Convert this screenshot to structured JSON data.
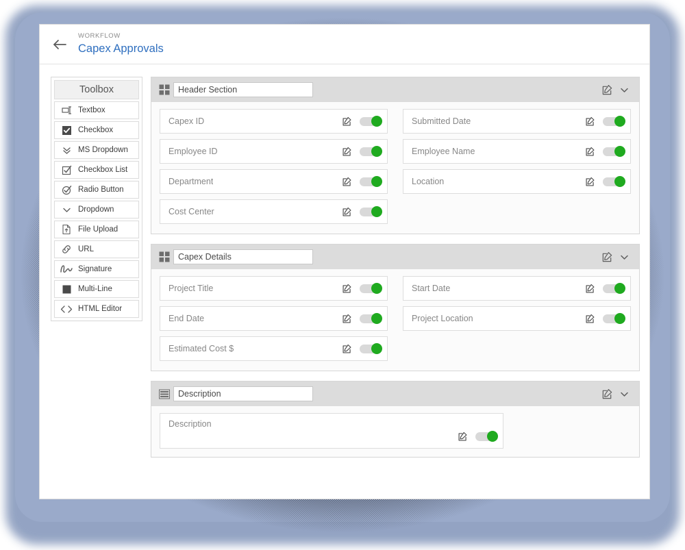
{
  "header": {
    "back_icon": "arrow-left-icon",
    "eyebrow": "WORKFLOW",
    "title": "Capex Approvals",
    "title_color": "#2f6fbf"
  },
  "toolbox": {
    "title": "Toolbox",
    "items": [
      {
        "label": "Textbox",
        "icon": "textbox-icon"
      },
      {
        "label": "Checkbox",
        "icon": "checkbox-checked-icon"
      },
      {
        "label": "MS Dropdown",
        "icon": "double-chevron-down-icon"
      },
      {
        "label": "Checkbox List",
        "icon": "checkbox-list-icon"
      },
      {
        "label": "Radio Button",
        "icon": "radio-button-icon"
      },
      {
        "label": "Dropdown",
        "icon": "chevron-down-icon"
      },
      {
        "label": "File Upload",
        "icon": "file-upload-icon"
      },
      {
        "label": "URL",
        "icon": "link-icon"
      },
      {
        "label": "Signature",
        "icon": "signature-icon"
      },
      {
        "label": "Multi-Line",
        "icon": "multiline-square-icon"
      },
      {
        "label": "HTML Editor",
        "icon": "code-brackets-icon"
      }
    ]
  },
  "canvas": {
    "sections": [
      {
        "title": "Header Section",
        "drag_icon": "grid-2x2-icon",
        "edit_icon": "edit-pencil-square-icon",
        "collapse_icon": "chevron-down-icon",
        "layout": "two-column",
        "rows": [
          [
            {
              "label": "Capex ID",
              "enabled": true
            },
            {
              "label": "Submitted Date",
              "enabled": true
            }
          ],
          [
            {
              "label": "Employee ID",
              "enabled": true
            },
            {
              "label": "Employee Name",
              "enabled": true
            }
          ],
          [
            {
              "label": "Department",
              "enabled": true
            },
            {
              "label": "Location",
              "enabled": true
            }
          ],
          [
            {
              "label": "Cost Center",
              "enabled": true
            },
            null
          ]
        ]
      },
      {
        "title": "Capex Details",
        "drag_icon": "grid-2x2-icon",
        "edit_icon": "edit-pencil-square-icon",
        "collapse_icon": "chevron-down-icon",
        "layout": "two-column",
        "rows": [
          [
            {
              "label": "Project Title",
              "enabled": true
            },
            {
              "label": "Start Date",
              "enabled": true
            }
          ],
          [
            {
              "label": "End Date",
              "enabled": true
            },
            {
              "label": "Project Location",
              "enabled": true
            }
          ],
          [
            {
              "label": "Estimated Cost $",
              "enabled": true
            },
            null
          ]
        ]
      },
      {
        "title": "Description",
        "drag_icon": "textarea-lines-icon",
        "edit_icon": "edit-pencil-square-icon",
        "collapse_icon": "chevron-down-icon",
        "layout": "textarea",
        "textarea": {
          "label": "Description",
          "enabled": true
        }
      }
    ]
  },
  "colors": {
    "accent_blue": "#2f6fbf",
    "toggle_on": "#1faa1f",
    "toggle_track": "#d9d9d9",
    "section_header_bg": "#dcdcdc",
    "frame_periwinkle": "#9aaaca"
  }
}
